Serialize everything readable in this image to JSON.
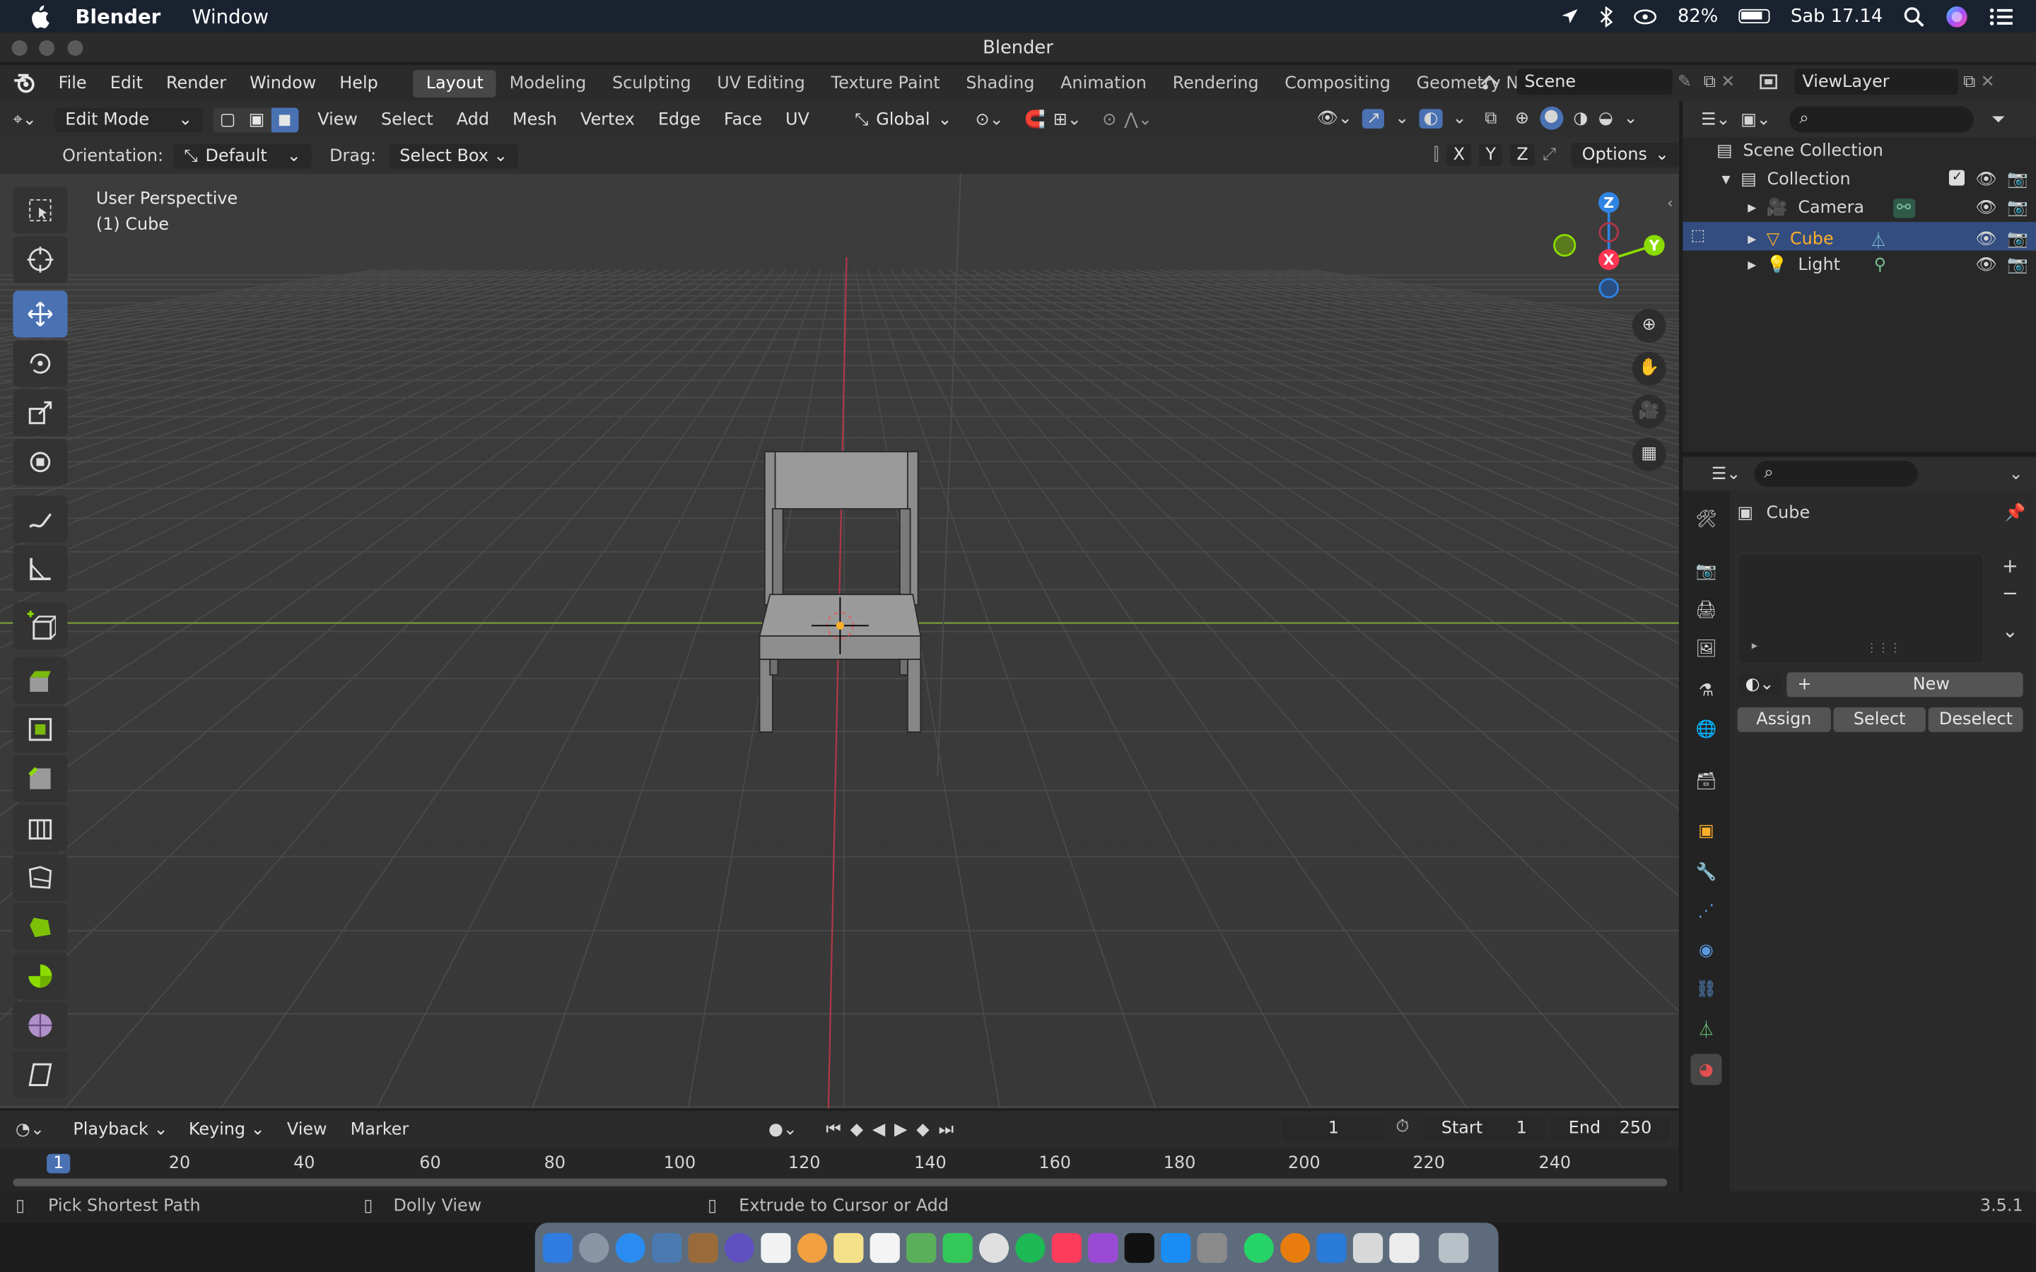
{
  "macos": {
    "app_name": "Blender",
    "menus": [
      "Window"
    ],
    "battery": "82%",
    "clock": "Sab 17.14"
  },
  "window_title": "Blender",
  "blender_menus": [
    "File",
    "Edit",
    "Render",
    "Window",
    "Help"
  ],
  "workspaces": [
    "Layout",
    "Modeling",
    "Sculpting",
    "UV Editing",
    "Texture Paint",
    "Shading",
    "Animation",
    "Rendering",
    "Compositing",
    "Geometry Nodes"
  ],
  "active_workspace": "Layout",
  "scene_name": "Scene",
  "view_layer": "ViewLayer",
  "viewport": {
    "mode": "Edit Mode",
    "menus": [
      "View",
      "Select",
      "Add",
      "Mesh",
      "Vertex",
      "Edge",
      "Face",
      "UV"
    ],
    "transform_orientation": "Global",
    "orientation_label": "Orientation:",
    "orientation_value": "Default",
    "drag_label": "Drag:",
    "drag_value": "Select Box",
    "axis_x": "X",
    "axis_y": "Y",
    "axis_z": "Z",
    "options_label": "Options",
    "overlay_line1": "User Perspective",
    "overlay_line2": "(1) Cube",
    "gizmo_z": "Z",
    "gizmo_y": "Y",
    "gizmo_x": "X"
  },
  "outliner": {
    "root": "Scene Collection",
    "collection": "Collection",
    "items": [
      "Camera",
      "Cube",
      "Light"
    ],
    "selected": "Cube"
  },
  "properties": {
    "object_name": "Cube",
    "new_label": "New",
    "assign_label": "Assign",
    "select_label": "Select",
    "deselect_label": "Deselect"
  },
  "timeline": {
    "menus": [
      "Playback",
      "Keying",
      "View",
      "Marker"
    ],
    "current_frame": "1",
    "start_label": "Start",
    "start_value": "1",
    "end_label": "End",
    "end_value": "250",
    "ruler": [
      "1",
      "20",
      "40",
      "60",
      "80",
      "100",
      "120",
      "140",
      "160",
      "180",
      "200",
      "220",
      "240"
    ]
  },
  "status": {
    "left": "Pick Shortest Path",
    "middle": "Dolly View",
    "right": "Extrude to Cursor or Add",
    "version": "3.5.1"
  },
  "colors": {
    "accent_blue": "#4a72b3",
    "selection_orange": "#ffaf29",
    "x_axis": "#ff3352",
    "y_axis": "#8bdc00",
    "z_axis": "#2f83e3"
  }
}
